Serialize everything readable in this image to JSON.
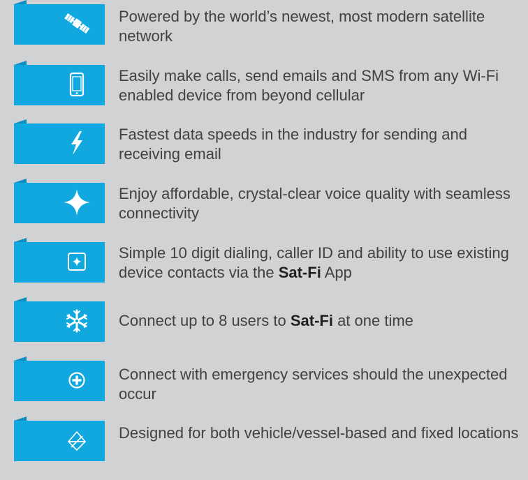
{
  "colors": {
    "background": "#d0d2d3",
    "badge": "#10a8de",
    "badge_fold": "#0b8fc0",
    "text": "#414042"
  },
  "features": [
    {
      "icon": "satellite-icon",
      "text_before": "Powered by the world’s newest, most modern satellite network",
      "bold": "",
      "text_after": ""
    },
    {
      "icon": "smartphone-icon",
      "text_before": "Easily make calls, send emails and SMS from any Wi-Fi enabled device from beyond cellular",
      "bold": "",
      "text_after": ""
    },
    {
      "icon": "lightning-icon",
      "text_before": "Fastest data speeds in the industry for sending and receiving email",
      "bold": "",
      "text_after": ""
    },
    {
      "icon": "sparkle-icon",
      "text_before": "Enjoy affordable, crystal-clear voice quality with seamless connectivity",
      "bold": "",
      "text_after": ""
    },
    {
      "icon": "dialpad-icon",
      "text_before": "Simple 10 digit dialing, caller ID and ability to use existing device contacts via the ",
      "bold": "Sat-Fi",
      "text_after": " App"
    },
    {
      "icon": "snowflake-users-icon",
      "text_before": "Connect up to 8 users to ",
      "bold": "Sat-Fi",
      "text_after": " at one time"
    },
    {
      "icon": "emergency-plus-icon",
      "text_before": "Connect with emergency services should the unexpected occur",
      "bold": "",
      "text_after": ""
    },
    {
      "icon": "location-star-icon",
      "text_before": "Designed for both vehicle/vessel-based and fixed locations",
      "bold": "",
      "text_after": ""
    }
  ]
}
